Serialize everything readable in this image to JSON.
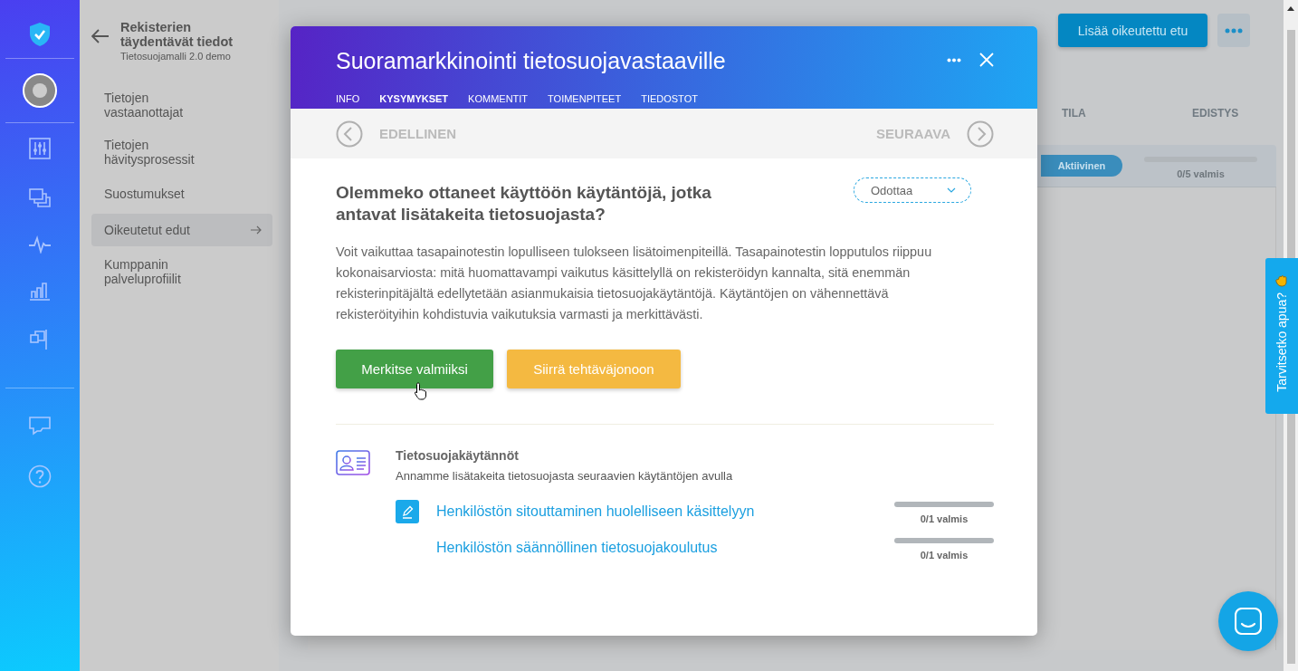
{
  "sidebar": {
    "title": "Rekisterien täydentävät tiedot",
    "subtitle": "Tietosuojamalli 2.0 demo",
    "items": [
      {
        "label": "Tietojen vastaanottajat",
        "selected": false
      },
      {
        "label": "Tietojen hävitysprosessit",
        "selected": false
      },
      {
        "label": "Suostumukset",
        "selected": false
      },
      {
        "label": "Oikeutetut edut",
        "selected": true
      },
      {
        "label": "Kumppanin palveluprofiilit",
        "selected": false
      }
    ]
  },
  "page": {
    "add_button": "Lisää oikeutettu etu",
    "columns": [
      "TILA",
      "EDISTYS"
    ],
    "row": {
      "status": "Aktiivinen",
      "level": 0,
      "progress": "0/5 valmis"
    }
  },
  "modal": {
    "title": "Suoramarkkinointi tietosuojavastaaville",
    "tabs": [
      {
        "label": "INFO",
        "selected": false
      },
      {
        "label": "KYSYMYKSET",
        "selected": true
      },
      {
        "label": "KOMMENTIT",
        "selected": false
      },
      {
        "label": "TOIMENPITEET",
        "selected": false
      },
      {
        "label": "TIEDOSTOT",
        "selected": false
      }
    ],
    "previous": "EDELLINEN",
    "next": "SEURAAVA",
    "question": "Olemmeko ottaneet käyttöön käytäntöjä, jotka antavat lisätakeita tietosuojasta?",
    "status": "Odottaa",
    "description": "Voit vaikuttaa tasapainotestin lopulliseen tulokseen lisätoimenpiteillä. Tasapainotestin lopputulos riippuu kokonaisarviosta: mitä huomattavampi vaikutus käsittelyllä on rekisteröidyn kannalta, sitä enemmän rekisterinpitäjältä edellytetään asianmukaisia tietosuojakäytäntöjä. Käytäntöjen on vähennettävä rekisteröityihin kohdistuvia vaikutuksia varmasti ja merkittävästi.",
    "done_button": "Merkitse valmiiksi",
    "queue_button": "Siirrä tehtäväjonoon",
    "section_title": "Tietosuojakäytännöt",
    "section_subtitle": "Annamme lisätakeita tietosuojasta seuraavien käytäntöjen avulla",
    "practices": [
      {
        "label": "Henkilöstön sitouttaminen huolelliseen käsittelyyn",
        "kind": "with-icon",
        "level": 0,
        "progress": "0/1 valmis"
      },
      {
        "label": "Henkilöstön säännöllinen tietosuojakoulutus",
        "kind": "plain",
        "level": 0,
        "progress": "0/1 valmis"
      }
    ]
  },
  "help_tab": "Tarvitsetko apua?"
}
